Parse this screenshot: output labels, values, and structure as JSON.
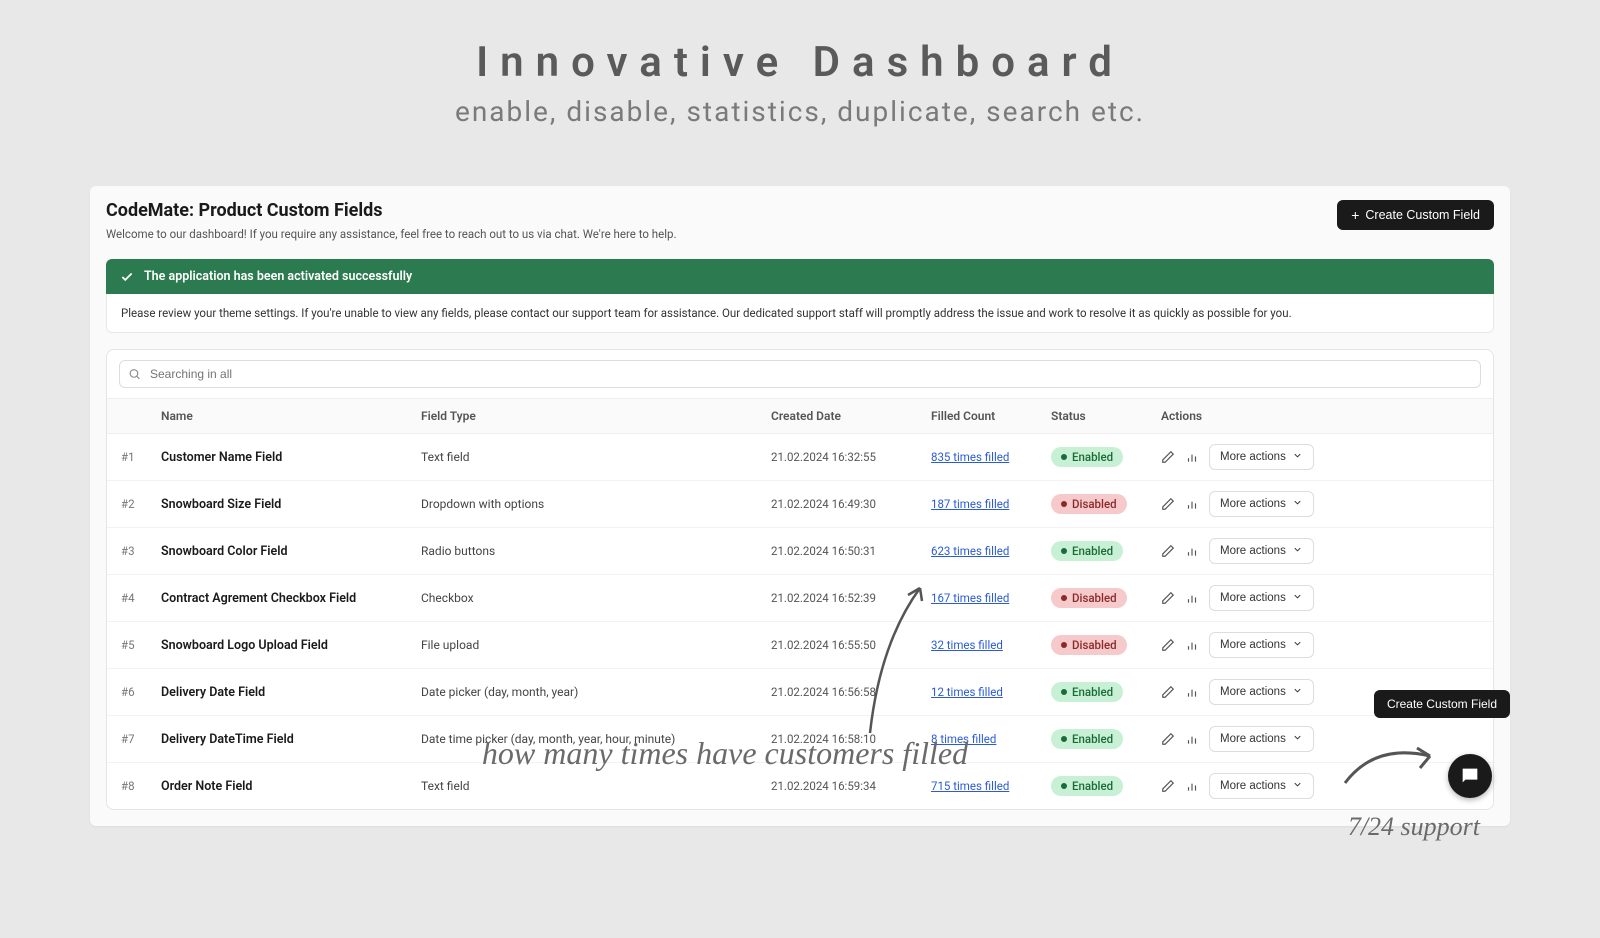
{
  "hero": {
    "title": "Innovative Dashboard",
    "subtitle": "enable, disable, statistics, duplicate, search etc."
  },
  "header": {
    "title": "CodeMate: Product Custom Fields",
    "welcome": "Welcome to our dashboard! If you require any assistance, feel free to reach out to us via chat. We're here to help.",
    "create_label": "Create Custom Field"
  },
  "banner": {
    "success": "The application has been activated successfully",
    "info": "Please review your theme settings. If you're unable to view any fields, please contact our support team for assistance. Our dedicated support staff will promptly address the issue and work to resolve it as quickly as possible for you."
  },
  "search": {
    "placeholder": "Searching in all"
  },
  "columns": {
    "name": "Name",
    "field_type": "Field Type",
    "created_date": "Created Date",
    "filled_count": "Filled Count",
    "status": "Status",
    "actions": "Actions"
  },
  "status_labels": {
    "enabled": "Enabled",
    "disabled": "Disabled"
  },
  "more_actions_label": "More actions",
  "rows": [
    {
      "idx": "#1",
      "name": "Customer Name Field",
      "type": "Text field",
      "date": "21.02.2024 16:32:55",
      "filled": "835 times filled",
      "status": "enabled"
    },
    {
      "idx": "#2",
      "name": "Snowboard Size Field",
      "type": "Dropdown with options",
      "date": "21.02.2024 16:49:30",
      "filled": "187 times filled",
      "status": "disabled"
    },
    {
      "idx": "#3",
      "name": "Snowboard Color Field",
      "type": "Radio buttons",
      "date": "21.02.2024 16:50:31",
      "filled": "623 times filled",
      "status": "enabled"
    },
    {
      "idx": "#4",
      "name": "Contract Agrement Checkbox Field",
      "type": "Checkbox",
      "date": "21.02.2024 16:52:39",
      "filled": "167 times filled",
      "status": "disabled"
    },
    {
      "idx": "#5",
      "name": "Snowboard Logo Upload Field",
      "type": "File upload",
      "date": "21.02.2024 16:55:50",
      "filled": "32 times filled",
      "status": "disabled"
    },
    {
      "idx": "#6",
      "name": "Delivery Date Field",
      "type": "Date picker (day, month, year)",
      "date": "21.02.2024 16:56:58",
      "filled": "12 times filled",
      "status": "enabled"
    },
    {
      "idx": "#7",
      "name": "Delivery DateTime Field",
      "type": "Date time picker (day, month, year, hour, minute)",
      "date": "21.02.2024 16:58:10",
      "filled": "8 times filled",
      "status": "enabled"
    },
    {
      "idx": "#8",
      "name": "Order Note Field",
      "type": "Text field",
      "date": "21.02.2024 16:59:34",
      "filled": "715 times filled",
      "status": "enabled"
    }
  ],
  "bottom_create_label": "Create Custom Field",
  "annotations": {
    "filled_note": "how many times have customers filled",
    "support_note": "7/24 support"
  }
}
